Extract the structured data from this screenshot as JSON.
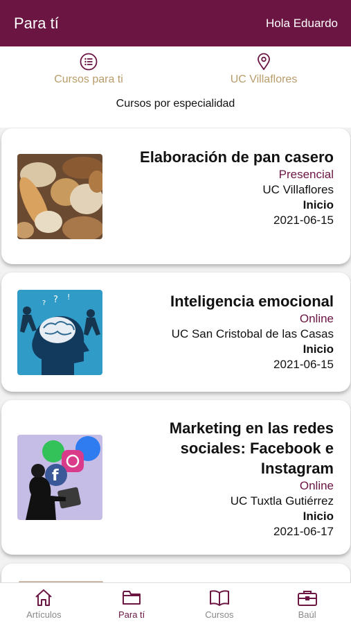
{
  "header": {
    "title": "Para tí",
    "greeting": "Hola Eduardo"
  },
  "filters": [
    {
      "label": "Cursos para ti",
      "icon": "list-icon"
    },
    {
      "label": "UC Villaflores",
      "icon": "location-pin-icon"
    }
  ],
  "subfilter": "Cursos por especialidad",
  "courses": [
    {
      "title": "Elaboración de pan casero",
      "mode": "Presencial",
      "unit": "UC Villaflores",
      "start_label": "Inicio",
      "start_date": "2021-06-15",
      "image": "bread-photo"
    },
    {
      "title": "Inteligencia emocional",
      "mode": "Online",
      "unit": "UC San Cristobal de las Casas",
      "start_label": "Inicio",
      "start_date": "2021-06-15",
      "image": "head-brain-illustration"
    },
    {
      "title": "Marketing en las redes sociales: Facebook e Instagram",
      "mode": "Online",
      "unit": "UC Tuxtla Gutiérrez",
      "start_label": "Inicio",
      "start_date": "2021-06-17",
      "image": "social-media-illustration"
    }
  ],
  "nav": [
    {
      "label": "Artículos",
      "icon": "home-icon",
      "active": false
    },
    {
      "label": "Para tí",
      "icon": "folder-icon",
      "active": true
    },
    {
      "label": "Cursos",
      "icon": "book-icon",
      "active": false
    },
    {
      "label": "Baúl",
      "icon": "briefcase-icon",
      "active": false
    }
  ],
  "colors": {
    "primary": "#6b1543",
    "accent": "#b89c6a"
  }
}
